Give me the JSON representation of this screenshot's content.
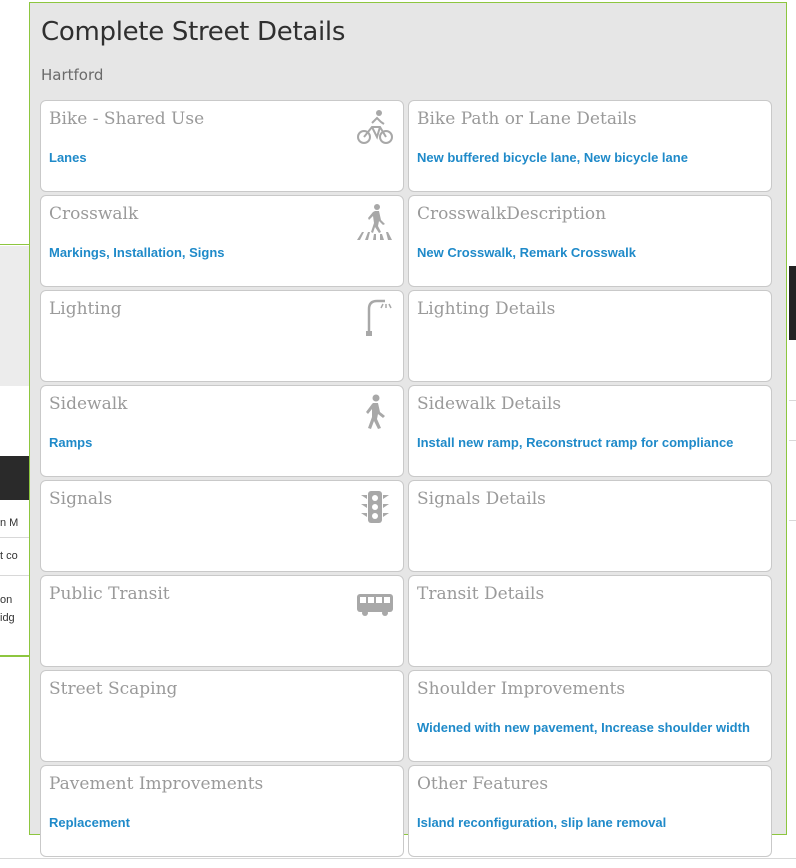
{
  "panel": {
    "title": "Complete Street Details",
    "subtitle": "Hartford"
  },
  "background": {
    "fragments": [
      "n M",
      "t co",
      "on",
      "idg"
    ]
  },
  "cards": [
    {
      "label": "Bike - Shared Use",
      "value": "Lanes",
      "icon": "bicycle-icon"
    },
    {
      "label": "Bike Path or Lane Details",
      "value": "New buffered bicycle lane, New bicycle lane"
    },
    {
      "label": "Crosswalk",
      "value": "Markings, Installation, Signs",
      "icon": "crosswalk-icon"
    },
    {
      "label": "CrosswalkDescription",
      "value": "New Crosswalk, Remark Crosswalk"
    },
    {
      "label": "Lighting",
      "value": "",
      "icon": "streetlight-icon"
    },
    {
      "label": "Lighting Details",
      "value": ""
    },
    {
      "label": "Sidewalk",
      "value": "Ramps",
      "icon": "pedestrian-icon"
    },
    {
      "label": "Sidewalk Details",
      "value": "Install new ramp, Reconstruct ramp for compliance"
    },
    {
      "label": "Signals",
      "value": "",
      "icon": "traffic-signal-icon"
    },
    {
      "label": "Signals Details",
      "value": ""
    },
    {
      "label": "Public Transit",
      "value": "",
      "icon": "bus-icon"
    },
    {
      "label": "Transit Details",
      "value": ""
    },
    {
      "label": "Street Scaping",
      "value": ""
    },
    {
      "label": "Shoulder Improvements",
      "value": "Widened with new pavement, Increase shoulder width"
    },
    {
      "label": "Pavement Improvements",
      "value": "Replacement"
    },
    {
      "label": "Other Features",
      "value": "Island reconfiguration, slip lane removal"
    }
  ],
  "colors": {
    "accent_border": "#8dc63f",
    "value_text": "#1f8ac9",
    "label_text": "#9a9a9a",
    "panel_bg": "#e6e6e6"
  }
}
